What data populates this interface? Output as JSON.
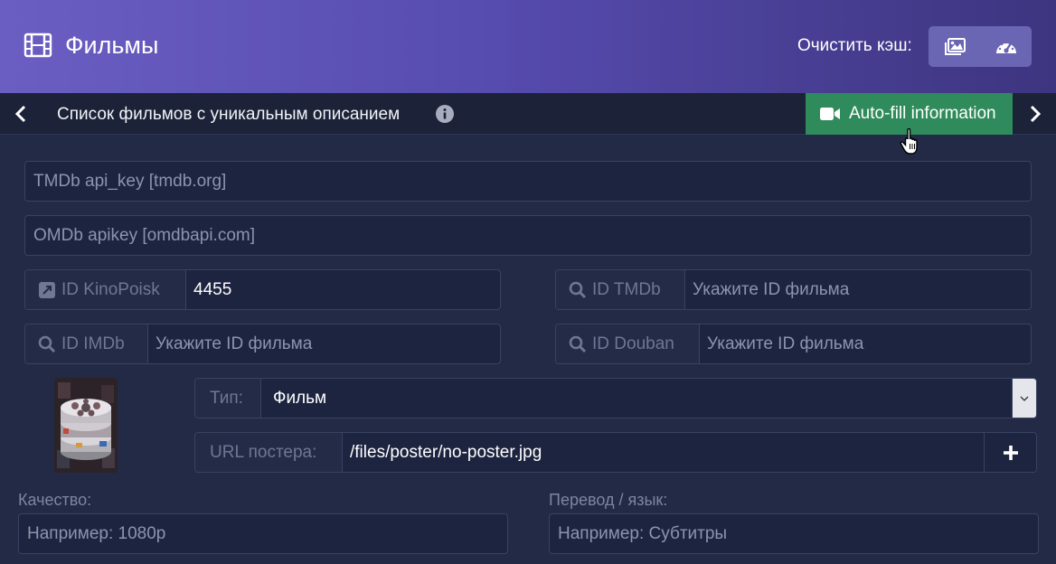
{
  "header": {
    "title": "Фильмы",
    "cache_label": "Очистить кэш:",
    "icons": [
      "film-icon",
      "images-icon",
      "gauge-icon"
    ]
  },
  "subbar": {
    "list_title": "Список фильмов с уникальным описанием",
    "autofill_label": "Auto-fill information",
    "autofill_color": "#2f8b5b"
  },
  "form": {
    "tmdb_api_placeholder": "TMDb api_key [tmdb.org]",
    "omdb_api_placeholder": "OMDb apikey [omdbapi.com]",
    "kinopoisk": {
      "label": "ID KinoPoisk",
      "value": "4455"
    },
    "tmdb_id": {
      "label": "ID TMDb",
      "placeholder": "Укажите ID фильма"
    },
    "imdb_id": {
      "label": "ID IMDb",
      "placeholder": "Укажите ID фильма"
    },
    "douban_id": {
      "label": "ID Douban",
      "placeholder": "Укажите ID фильма"
    },
    "type": {
      "label": "Тип:",
      "value": "Фильм"
    },
    "poster_url": {
      "label": "URL постера:",
      "value": "/files/poster/no-poster.jpg"
    },
    "quality": {
      "label": "Качество:",
      "placeholder": "Например: 1080p"
    },
    "translation": {
      "label": "Перевод / язык:",
      "placeholder": "Например: Субтитры"
    }
  }
}
